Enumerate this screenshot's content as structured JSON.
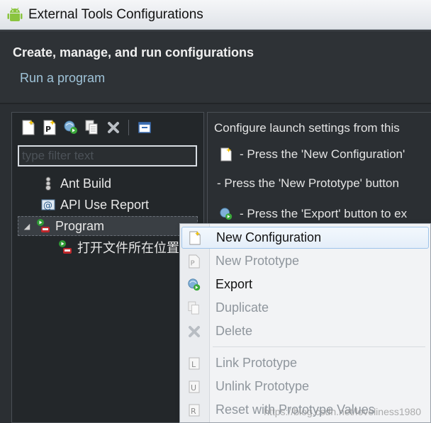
{
  "window": {
    "title": "External Tools Configurations",
    "header_title": "Create, manage, and run configurations",
    "header_subtitle": "Run a program"
  },
  "left": {
    "toolbar_icons": [
      "new-config-icon",
      "new-prototype-icon",
      "export-icon",
      "duplicate-icon",
      "delete-icon",
      "collapse-all-icon"
    ],
    "filter_placeholder": "type filter text",
    "tree": [
      {
        "label": "Ant Build",
        "icon": "ant-build-icon",
        "level": 0
      },
      {
        "label": "API Use Report",
        "icon": "api-report-icon",
        "level": 0
      },
      {
        "label": "Program",
        "icon": "program-icon",
        "level": 0,
        "expanded": true
      },
      {
        "label": "打开文件所在位置",
        "icon": "program-config-icon",
        "level": 1
      }
    ]
  },
  "right": {
    "line1": "Configure launch settings from this",
    "line2": "- Press the 'New Configuration'",
    "line3": "- Press the 'New Prototype' button",
    "line4": "- Press the 'Export' button to ex"
  },
  "context_menu": {
    "items": [
      {
        "label": "New Configuration",
        "icon": "new-config-icon",
        "enabled": true,
        "hover": true
      },
      {
        "label": "New Prototype",
        "icon": "new-prototype-icon",
        "enabled": false
      },
      {
        "label": "Export",
        "icon": "export-icon",
        "enabled": true
      },
      {
        "label": "Duplicate",
        "icon": "duplicate-icon",
        "enabled": false
      },
      {
        "label": "Delete",
        "icon": "delete-icon",
        "enabled": false
      },
      {
        "label": "Link Prototype",
        "icon": "link-prototype-icon",
        "enabled": false
      },
      {
        "label": "Unlink Prototype",
        "icon": "unlink-prototype-icon",
        "enabled": false
      },
      {
        "label": "Reset with Prototype Values",
        "icon": "reset-prototype-icon",
        "enabled": false
      }
    ]
  },
  "watermark": "https://blog.csdn.net/loveliness1980"
}
